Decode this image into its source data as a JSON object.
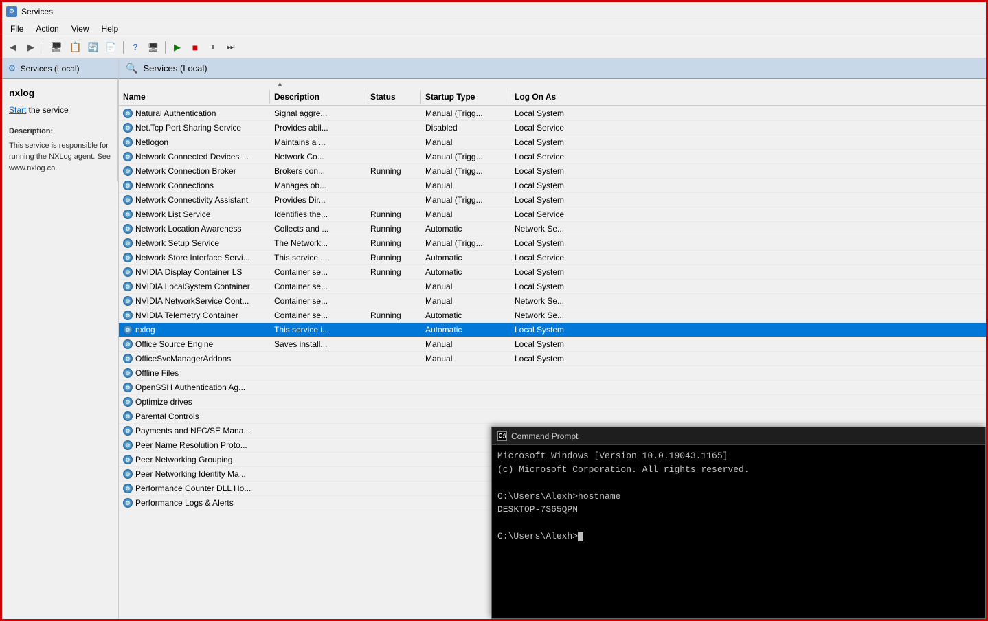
{
  "window": {
    "title": "Services",
    "title_icon": "⚙"
  },
  "menu": {
    "items": [
      "File",
      "Action",
      "View",
      "Help"
    ]
  },
  "toolbar": {
    "buttons": [
      {
        "name": "back",
        "icon": "◀"
      },
      {
        "name": "forward",
        "icon": "▶"
      },
      {
        "name": "up",
        "icon": "📂"
      },
      {
        "name": "view1",
        "icon": "📋"
      },
      {
        "name": "refresh",
        "icon": "🔄"
      },
      {
        "name": "export",
        "icon": "📄"
      },
      {
        "name": "help",
        "icon": "❓"
      },
      {
        "name": "prop",
        "icon": "🖥"
      },
      {
        "name": "play",
        "icon": "▶"
      },
      {
        "name": "stop",
        "icon": "■"
      },
      {
        "name": "pause",
        "icon": "⏸"
      },
      {
        "name": "resume",
        "icon": "⏭"
      }
    ]
  },
  "sidebar": {
    "label": "Services (Local)",
    "detail": {
      "service_name": "nxlog",
      "start_label": "Start",
      "start_text": " the service",
      "description_title": "Description:",
      "description_text": "This service is responsible for running the NXLog agent. See www.nxlog.co."
    }
  },
  "services_header": {
    "icon": "🔍",
    "label": "Services (Local)"
  },
  "table": {
    "columns": [
      "Name",
      "Description",
      "Status",
      "Startup Type",
      "Log On As"
    ],
    "sort_col": 0,
    "rows": [
      {
        "name": "Natural Authentication",
        "desc": "Signal aggre...",
        "status": "",
        "startup": "Manual (Trigg...",
        "logon": "Local System"
      },
      {
        "name": "Net.Tcp Port Sharing Service",
        "desc": "Provides abil...",
        "status": "",
        "startup": "Disabled",
        "logon": "Local Service"
      },
      {
        "name": "Netlogon",
        "desc": "Maintains a ...",
        "status": "",
        "startup": "Manual",
        "logon": "Local System"
      },
      {
        "name": "Network Connected Devices ...",
        "desc": "Network Co...",
        "status": "",
        "startup": "Manual (Trigg...",
        "logon": "Local Service"
      },
      {
        "name": "Network Connection Broker",
        "desc": "Brokers con...",
        "status": "Running",
        "startup": "Manual (Trigg...",
        "logon": "Local System"
      },
      {
        "name": "Network Connections",
        "desc": "Manages ob...",
        "status": "",
        "startup": "Manual",
        "logon": "Local System"
      },
      {
        "name": "Network Connectivity Assistant",
        "desc": "Provides Dir...",
        "status": "",
        "startup": "Manual (Trigg...",
        "logon": "Local System"
      },
      {
        "name": "Network List Service",
        "desc": "Identifies the...",
        "status": "Running",
        "startup": "Manual",
        "logon": "Local Service"
      },
      {
        "name": "Network Location Awareness",
        "desc": "Collects and ...",
        "status": "Running",
        "startup": "Automatic",
        "logon": "Network Se..."
      },
      {
        "name": "Network Setup Service",
        "desc": "The Network...",
        "status": "Running",
        "startup": "Manual (Trigg...",
        "logon": "Local System"
      },
      {
        "name": "Network Store Interface Servi...",
        "desc": "This service ...",
        "status": "Running",
        "startup": "Automatic",
        "logon": "Local Service"
      },
      {
        "name": "NVIDIA Display Container LS",
        "desc": "Container se...",
        "status": "Running",
        "startup": "Automatic",
        "logon": "Local System"
      },
      {
        "name": "NVIDIA LocalSystem Container",
        "desc": "Container se...",
        "status": "",
        "startup": "Manual",
        "logon": "Local System"
      },
      {
        "name": "NVIDIA NetworkService Cont...",
        "desc": "Container se...",
        "status": "",
        "startup": "Manual",
        "logon": "Network Se..."
      },
      {
        "name": "NVIDIA Telemetry Container",
        "desc": "Container se...",
        "status": "Running",
        "startup": "Automatic",
        "logon": "Network Se..."
      },
      {
        "name": "nxlog",
        "desc": "This service i...",
        "status": "",
        "startup": "Automatic",
        "logon": "Local System"
      },
      {
        "name": "Office  Source Engine",
        "desc": "Saves install...",
        "status": "",
        "startup": "Manual",
        "logon": "Local System"
      },
      {
        "name": "OfficeSvcManagerAddons",
        "desc": "",
        "status": "",
        "startup": "Manual",
        "logon": "Local System"
      },
      {
        "name": "Offline Files",
        "desc": "",
        "status": "",
        "startup": "",
        "logon": ""
      },
      {
        "name": "OpenSSH Authentication Ag...",
        "desc": "",
        "status": "",
        "startup": "",
        "logon": ""
      },
      {
        "name": "Optimize drives",
        "desc": "",
        "status": "",
        "startup": "",
        "logon": ""
      },
      {
        "name": "Parental Controls",
        "desc": "",
        "status": "",
        "startup": "",
        "logon": ""
      },
      {
        "name": "Payments and NFC/SE Mana...",
        "desc": "",
        "status": "",
        "startup": "",
        "logon": ""
      },
      {
        "name": "Peer Name Resolution Proto...",
        "desc": "",
        "status": "",
        "startup": "",
        "logon": ""
      },
      {
        "name": "Peer Networking Grouping",
        "desc": "",
        "status": "",
        "startup": "",
        "logon": ""
      },
      {
        "name": "Peer Networking Identity Ma...",
        "desc": "",
        "status": "",
        "startup": "",
        "logon": ""
      },
      {
        "name": "Performance Counter DLL Ho...",
        "desc": "",
        "status": "",
        "startup": "",
        "logon": ""
      },
      {
        "name": "Performance Logs & Alerts",
        "desc": "",
        "status": "",
        "startup": "",
        "logon": ""
      }
    ]
  },
  "cmd": {
    "title": "Command Prompt",
    "title_icon": "C:\\",
    "lines": [
      "Microsoft Windows [Version 10.0.19043.1165]",
      "(c) Microsoft Corporation. All rights reserved.",
      "",
      "C:\\Users\\Alexh>hostname",
      "DESKTOP-7S65QPN",
      "",
      "C:\\Users\\Alexh>"
    ]
  }
}
